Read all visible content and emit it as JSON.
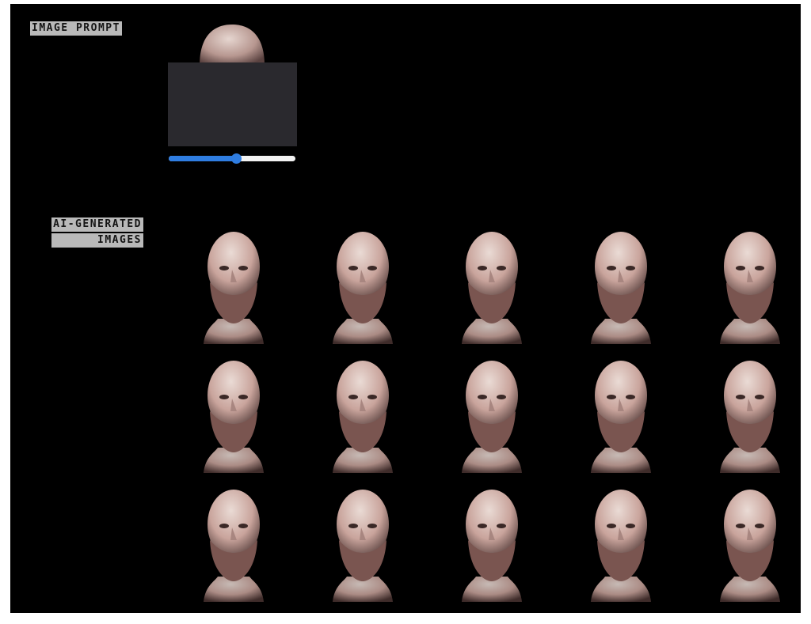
{
  "labels": {
    "image_prompt": "IMAGE PROMPT",
    "ai_generated_line1": "AI-GENERATED",
    "ai_generated_line2": "IMAGES"
  },
  "slider": {
    "value": 0.53
  },
  "colors": {
    "background": "#000000",
    "label_bg": "#b9b9b9",
    "prompt_box": "#2a292e",
    "slider_accent": "#2f7de1",
    "slider_track": "#f2f2f2",
    "bust_stone": "#c9a49c"
  },
  "generated_images": [
    {
      "icon": "bust-image"
    },
    {
      "icon": "bust-image"
    },
    {
      "icon": "bust-image"
    },
    {
      "icon": "bust-image"
    },
    {
      "icon": "bust-image"
    },
    {
      "icon": "bust-image"
    },
    {
      "icon": "bust-image"
    },
    {
      "icon": "bust-image"
    },
    {
      "icon": "bust-image"
    },
    {
      "icon": "bust-image"
    },
    {
      "icon": "bust-image"
    },
    {
      "icon": "bust-image"
    },
    {
      "icon": "bust-image"
    },
    {
      "icon": "bust-image"
    },
    {
      "icon": "bust-image"
    }
  ]
}
